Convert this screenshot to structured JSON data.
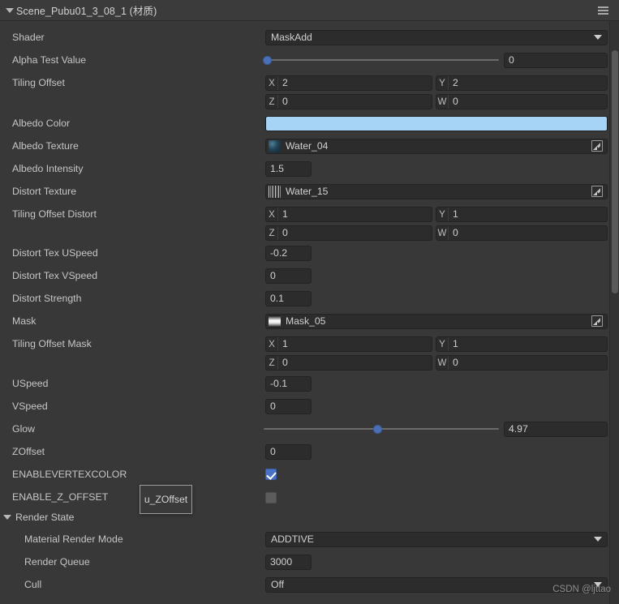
{
  "header": {
    "title": "Scene_Pubu01_3_08_1 (材质)",
    "foldout_icon": "triangle-down-icon",
    "menu_icon": "hamburger-menu-icon"
  },
  "colors": {
    "panel_bg": "#383838",
    "header_bg": "#3b3b3b",
    "field_bg": "#2c2c2c",
    "accent_blue": "#4a72c4",
    "albedo_color": "#a6d4f7",
    "label_text": "#c6c6c6"
  },
  "rows": {
    "shader": {
      "label": "Shader",
      "value": "MaskAdd"
    },
    "alpha_test_value": {
      "label": "Alpha Test Value",
      "value": "0",
      "slider_percent": 0
    },
    "tiling_offset": {
      "label": "Tiling Offset",
      "x_axis": "X",
      "x": "2",
      "y_axis": "Y",
      "y": "2",
      "z_axis": "Z",
      "z": "0",
      "w_axis": "W",
      "w": "0"
    },
    "albedo_color": {
      "label": "Albedo Color",
      "swatch": "#a6d4f7"
    },
    "albedo_texture": {
      "label": "Albedo Texture",
      "value": "Water_04",
      "thumb": "water-texture-thumbnail",
      "picker_icon": "object-picker-icon"
    },
    "albedo_intensity": {
      "label": "Albedo Intensity",
      "value": "1.5"
    },
    "distort_texture": {
      "label": "Distort Texture",
      "value": "Water_15",
      "thumb": "water-texture-thumbnail",
      "picker_icon": "object-picker-icon"
    },
    "tiling_offset_distort": {
      "label": "Tiling Offset Distort",
      "x_axis": "X",
      "x": "1",
      "y_axis": "Y",
      "y": "1",
      "z_axis": "Z",
      "z": "0",
      "w_axis": "W",
      "w": "0"
    },
    "distort_tex_uspeed": {
      "label": "Distort Tex USpeed",
      "value": "-0.2"
    },
    "distort_tex_vspeed": {
      "label": "Distort Tex VSpeed",
      "value": "0"
    },
    "distort_strength": {
      "label": "Distort Strength",
      "value": "0.1"
    },
    "mask": {
      "label": "Mask",
      "value": "Mask_05",
      "thumb": "gradient-mask-thumbnail",
      "picker_icon": "object-picker-icon"
    },
    "tiling_offset_mask": {
      "label": "Tiling Offset Mask",
      "x_axis": "X",
      "x": "1",
      "y_axis": "Y",
      "y": "1",
      "z_axis": "Z",
      "z": "0",
      "w_axis": "W",
      "w": "0"
    },
    "uspeed": {
      "label": "USpeed",
      "value": "-0.1"
    },
    "vspeed": {
      "label": "VSpeed",
      "value": "0"
    },
    "glow": {
      "label": "Glow",
      "value": "4.97",
      "slider_percent": 48.5
    },
    "zoffset": {
      "label": "ZOffset",
      "value": "0"
    },
    "enable_vertex_color": {
      "label": "ENABLEVERTEXCOLOR",
      "checked": true
    },
    "enable_z_offset": {
      "label": "ENABLE_Z_OFFSET",
      "checked": false
    }
  },
  "tooltip": {
    "text": "u_ZOffset"
  },
  "render_state": {
    "title": "Render State",
    "material_render_mode": {
      "label": "Material Render Mode",
      "value": "ADDTIVE"
    },
    "render_queue": {
      "label": "Render Queue",
      "value": "3000"
    },
    "cull": {
      "label": "Cull",
      "value": "Off"
    }
  },
  "watermark": {
    "text": "CSDN @ljttao"
  }
}
